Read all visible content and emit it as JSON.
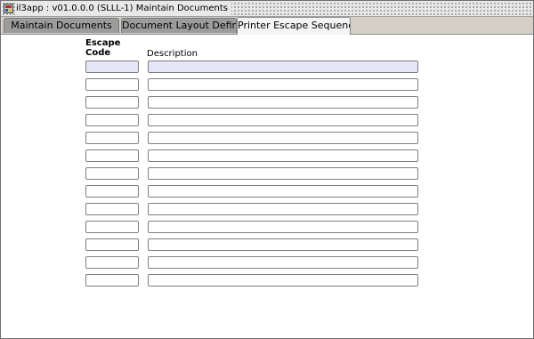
{
  "window": {
    "title": "il3app : v01.0.0.0 (SLLL-1) Maintain Documents",
    "icon": "app-window-icon"
  },
  "tabs": [
    {
      "label": "Maintain Documents",
      "active": false
    },
    {
      "label": "Document Layout Definition",
      "active": false
    },
    {
      "label": "Printer Escape Sequences",
      "active": true
    }
  ],
  "grid": {
    "headers": {
      "code_line1": "Escape",
      "code_line2": "Code",
      "description": "Description"
    },
    "rows": [
      {
        "code": "",
        "description": ""
      },
      {
        "code": "",
        "description": ""
      },
      {
        "code": "",
        "description": ""
      },
      {
        "code": "",
        "description": ""
      },
      {
        "code": "",
        "description": ""
      },
      {
        "code": "",
        "description": ""
      },
      {
        "code": "",
        "description": ""
      },
      {
        "code": "",
        "description": ""
      },
      {
        "code": "",
        "description": ""
      },
      {
        "code": "",
        "description": ""
      },
      {
        "code": "",
        "description": ""
      },
      {
        "code": "",
        "description": ""
      },
      {
        "code": "",
        "description": ""
      }
    ],
    "current_row": 0
  },
  "colors": {
    "background": "#d4d0c8",
    "active_tab": "#f4f4f4",
    "inactive_tab": "#9c9c9c",
    "current_row_fill": "#e6e6f8",
    "field_border": "#7f7f7f"
  }
}
